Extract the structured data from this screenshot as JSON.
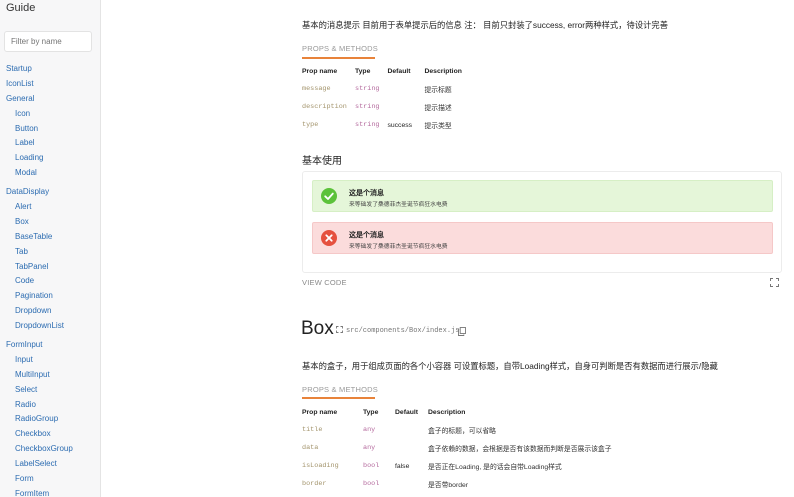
{
  "sidebar": {
    "brand": "Guide",
    "filter_placeholder": "Filter by name",
    "items": [
      {
        "label": "Startup",
        "level": 0
      },
      {
        "label": "IconList",
        "level": 0
      },
      {
        "label": "General",
        "level": 0
      },
      {
        "label": "Icon",
        "level": 1
      },
      {
        "label": "Button",
        "level": 1
      },
      {
        "label": "Label",
        "level": 1
      },
      {
        "label": "Loading",
        "level": 1
      },
      {
        "label": "Modal",
        "level": 1
      },
      {
        "label": "DataDisplay",
        "level": 0,
        "gap": true
      },
      {
        "label": "Alert",
        "level": 1
      },
      {
        "label": "Box",
        "level": 1
      },
      {
        "label": "BaseTable",
        "level": 1
      },
      {
        "label": "Tab",
        "level": 1
      },
      {
        "label": "TabPanel",
        "level": 1
      },
      {
        "label": "Code",
        "level": 1
      },
      {
        "label": "Pagination",
        "level": 1
      },
      {
        "label": "Dropdown",
        "level": 1
      },
      {
        "label": "DropdownList",
        "level": 1
      },
      {
        "label": "FormInput",
        "level": 0,
        "gap": true
      },
      {
        "label": "Input",
        "level": 1
      },
      {
        "label": "MultiInput",
        "level": 1
      },
      {
        "label": "Select",
        "level": 1
      },
      {
        "label": "Radio",
        "level": 1
      },
      {
        "label": "RadioGroup",
        "level": 1
      },
      {
        "label": "Checkbox",
        "level": 1
      },
      {
        "label": "CheckboxGroup",
        "level": 1
      },
      {
        "label": "LabelSelect",
        "level": 1
      },
      {
        "label": "Form",
        "level": 1
      },
      {
        "label": "FormItem",
        "level": 1
      }
    ]
  },
  "alert_section": {
    "description": "基本的消息提示 目前用于表单提示后的信息 注： 目前只封装了success, error两种样式，待设计完善",
    "props_heading": "PROPS & METHODS",
    "columns": [
      "Prop name",
      "Type",
      "Default",
      "Description"
    ],
    "rows": [
      {
        "name": "message",
        "type": "string",
        "default": "",
        "description": "提示标题"
      },
      {
        "name": "description",
        "type": "string",
        "default": "",
        "description": "提示描述"
      },
      {
        "name": "type",
        "type": "string",
        "default": "success",
        "description": "提示类型"
      }
    ],
    "usage_heading": "基本使用",
    "alerts": [
      {
        "kind": "success",
        "title": "这是个消息",
        "text": "来等础发了桑德菲杰圣诞节疯狂水电费",
        "color": "#5cc23a"
      },
      {
        "kind": "error",
        "title": "这是个消息",
        "text": "来等础发了桑德菲杰圣诞节疯狂水电费",
        "color": "#e5513f"
      }
    ],
    "view_code": "VIEW CODE"
  },
  "box_section": {
    "title": "Box",
    "path": "src/components/Box/index.js",
    "description": "基本的盒子，用于组成页面的各个小容器 可设置标题，自带Loading样式，自身可判断是否有数据而进行展示/隐藏",
    "props_heading": "PROPS & METHODS",
    "columns": [
      "Prop name",
      "Type",
      "Default",
      "Description"
    ],
    "rows": [
      {
        "name": "title",
        "type": "any",
        "default": "",
        "description": "盒子的标题，可以省略"
      },
      {
        "name": "data",
        "type": "any",
        "default": "",
        "description": "盒子依赖的数据，会根据是否有该数据而判断是否展示该盒子"
      },
      {
        "name": "isLoading",
        "type": "bool",
        "default": "false",
        "description": "是否正在Loading, 是的话会自带Loading样式"
      },
      {
        "name": "border",
        "type": "bool",
        "default": "",
        "description": "是否带border"
      }
    ]
  },
  "colors": {
    "link": "#2c6cb1",
    "accent": "#e8833a",
    "prop_name": "#a3946c",
    "prop_type": "#b56b9e"
  }
}
